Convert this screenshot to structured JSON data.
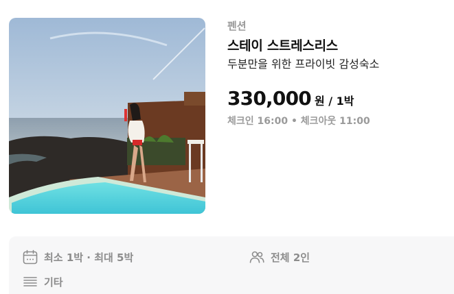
{
  "listing": {
    "category": "펜션",
    "title": "스테이 스트레스리스",
    "subtitle": "두분만을 위한 프라이빗 감성숙소",
    "price": "330,000",
    "price_unit": "원 / 1박",
    "checkin_checkout": "체크인 16:00 • 체크아웃 11:00"
  },
  "options": {
    "stay_length": "최소 1박 · 최대 5박",
    "guests": "전체 2인",
    "etc": "기타"
  },
  "icons": {
    "stay_length": "calendar-icon",
    "guests": "people-icon",
    "etc": "lines-icon"
  },
  "colors": {
    "muted_text": "#9a9a9a",
    "panel_background": "#f7f7f8"
  }
}
